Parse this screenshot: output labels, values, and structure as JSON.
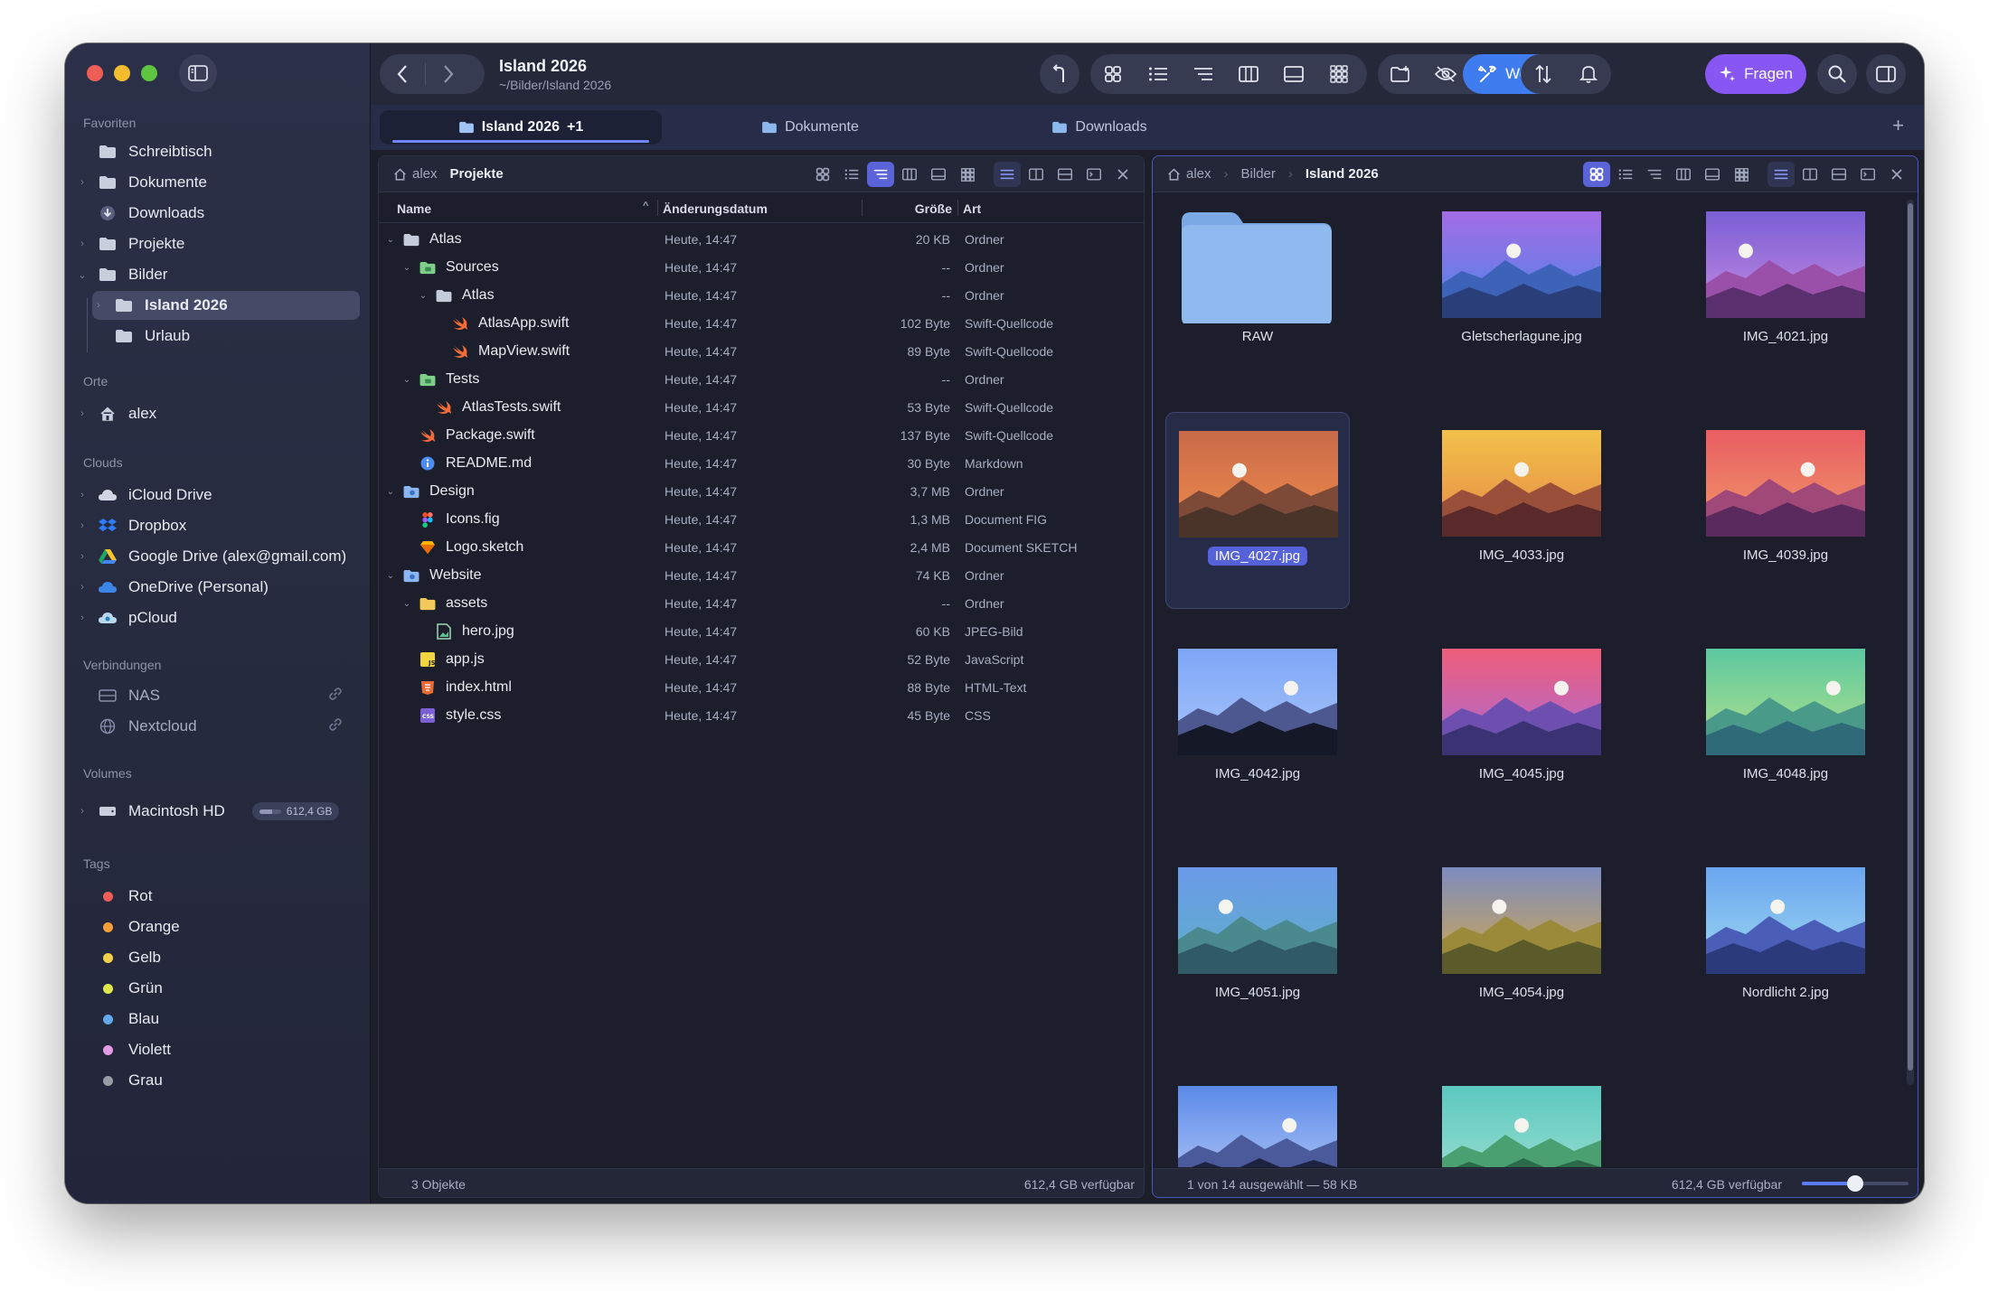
{
  "window": {
    "title": "Island 2026",
    "path": "~/Bilder/Island 2026"
  },
  "toolbar": {
    "tools_label": "Werkzeuge",
    "ask_label": "Fragen"
  },
  "tabs": [
    {
      "label": "Island 2026",
      "badge": "+1"
    },
    {
      "label": "Dokumente"
    },
    {
      "label": "Downloads"
    }
  ],
  "sidebar": {
    "favorites_title": "Favoriten",
    "favorites": [
      "Schreibtisch",
      "Dokumente",
      "Downloads",
      "Projekte",
      "Bilder",
      "Island 2026",
      "Urlaub"
    ],
    "places_title": "Orte",
    "places": [
      "alex"
    ],
    "clouds_title": "Clouds",
    "clouds": [
      "iCloud Drive",
      "Dropbox",
      "Google Drive (alex@gmail.com)",
      "OneDrive (Personal)",
      "pCloud"
    ],
    "connections_title": "Verbindungen",
    "connections": [
      "NAS",
      "Nextcloud"
    ],
    "volumes_title": "Volumes",
    "volume": {
      "name": "Macintosh HD",
      "free": "612,4 GB",
      "used_fraction": 0.6
    },
    "tags_title": "Tags",
    "tags": [
      {
        "name": "Rot",
        "color": "#ef5f58"
      },
      {
        "name": "Orange",
        "color": "#f5a03b"
      },
      {
        "name": "Gelb",
        "color": "#f1d04a"
      },
      {
        "name": "Grün",
        "color": "#dfe94d"
      },
      {
        "name": "Blau",
        "color": "#63a9ee"
      },
      {
        "name": "Violett",
        "color": "#e39be6"
      },
      {
        "name": "Grau",
        "color": "#9a9ca5"
      }
    ]
  },
  "left_pane": {
    "breadcrumb": {
      "root": "alex",
      "current": "Projekte"
    },
    "columns": {
      "name": "Name",
      "date": "Änderungsdatum",
      "size": "Größe",
      "kind": "Art"
    },
    "rows": [
      {
        "name": "Atlas",
        "date": "Heute, 14:47",
        "size": "20 KB",
        "kind": "Ordner"
      },
      {
        "name": "Sources",
        "date": "Heute, 14:47",
        "size": "--",
        "kind": "Ordner"
      },
      {
        "name": "Atlas",
        "date": "Heute, 14:47",
        "size": "--",
        "kind": "Ordner"
      },
      {
        "name": "AtlasApp.swift",
        "date": "Heute, 14:47",
        "size": "102 Byte",
        "kind": "Swift-Quellcode"
      },
      {
        "name": "MapView.swift",
        "date": "Heute, 14:47",
        "size": "89 Byte",
        "kind": "Swift-Quellcode"
      },
      {
        "name": "Tests",
        "date": "Heute, 14:47",
        "size": "--",
        "kind": "Ordner"
      },
      {
        "name": "AtlasTests.swift",
        "date": "Heute, 14:47",
        "size": "53 Byte",
        "kind": "Swift-Quellcode"
      },
      {
        "name": "Package.swift",
        "date": "Heute, 14:47",
        "size": "137 Byte",
        "kind": "Swift-Quellcode"
      },
      {
        "name": "README.md",
        "date": "Heute, 14:47",
        "size": "30 Byte",
        "kind": "Markdown"
      },
      {
        "name": "Design",
        "date": "Heute, 14:47",
        "size": "3,7 MB",
        "kind": "Ordner"
      },
      {
        "name": "Icons.fig",
        "date": "Heute, 14:47",
        "size": "1,3 MB",
        "kind": "Document FIG"
      },
      {
        "name": "Logo.sketch",
        "date": "Heute, 14:47",
        "size": "2,4 MB",
        "kind": "Document SKETCH"
      },
      {
        "name": "Website",
        "date": "Heute, 14:47",
        "size": "74 KB",
        "kind": "Ordner"
      },
      {
        "name": "assets",
        "date": "Heute, 14:47",
        "size": "--",
        "kind": "Ordner"
      },
      {
        "name": "hero.jpg",
        "date": "Heute, 14:47",
        "size": "60 KB",
        "kind": "JPEG-Bild"
      },
      {
        "name": "app.js",
        "date": "Heute, 14:47",
        "size": "52 Byte",
        "kind": "JavaScript"
      },
      {
        "name": "index.html",
        "date": "Heute, 14:47",
        "size": "88 Byte",
        "kind": "HTML-Text"
      },
      {
        "name": "style.css",
        "date": "Heute, 14:47",
        "size": "45 Byte",
        "kind": "CSS"
      }
    ],
    "footer_left": "3 Objekte",
    "footer_right": "612,4 GB verfügbar"
  },
  "right_pane": {
    "breadcrumb": {
      "root": "alex",
      "middle": "Bilder",
      "current": "Island 2026"
    },
    "items": [
      "RAW",
      "Gletscherlagune.jpg",
      "IMG_4021.jpg",
      "IMG_4027.jpg",
      "IMG_4033.jpg",
      "IMG_4039.jpg",
      "IMG_4042.jpg",
      "IMG_4045.jpg",
      "IMG_4048.jpg",
      "IMG_4051.jpg",
      "IMG_4054.jpg",
      "Nordlicht 2.jpg"
    ],
    "footer_left": "1 von 14 ausgewählt — 58 KB",
    "footer_right": "612,4 GB verfügbar",
    "zoom_fraction": 0.5
  }
}
